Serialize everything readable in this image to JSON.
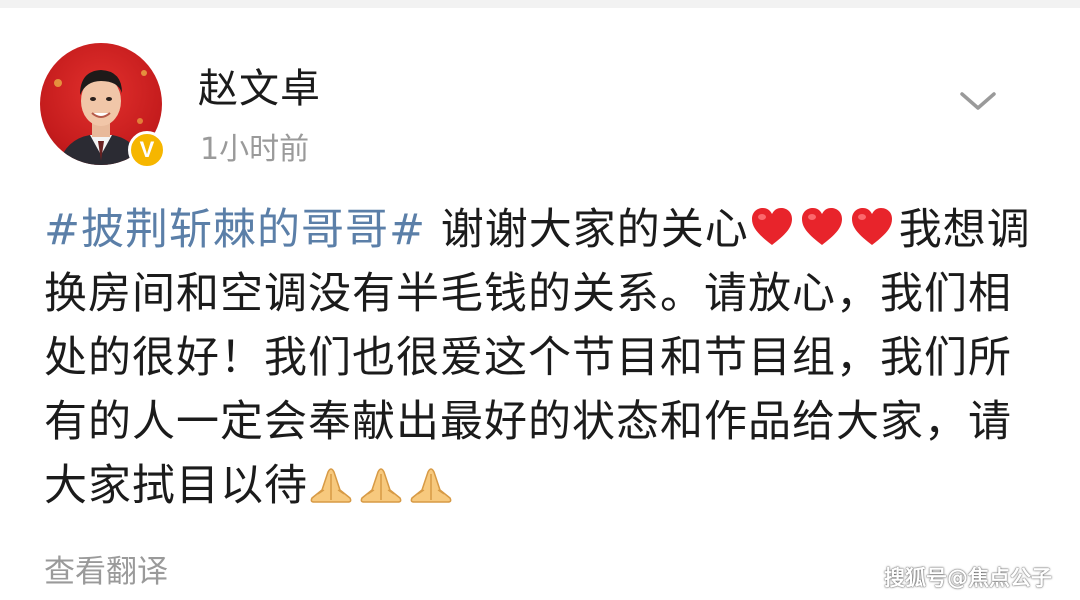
{
  "post": {
    "author": {
      "name": "赵文卓",
      "verified_badge": "V",
      "verified_color": "#f6b600"
    },
    "time": "1小时前",
    "menu_icon": "chevron-down-icon",
    "content": {
      "topic": "#披荆斩棘的哥哥#",
      "text_1": " 谢谢大家的关心",
      "heart_emoji_count": 3,
      "text_2": "我想调换房间和空调没有半毛钱的关系。请放心，我们相处的很好！我们也很爱这个节目和节目组，我们所有的人一定会奉献出最好的状态和作品给大家，请大家拭目以待",
      "hand_emoji_count": 3
    },
    "translate_label": "查看翻译",
    "topic_color": "#5b7fa8"
  },
  "watermark": "搜狐号@焦点公子"
}
